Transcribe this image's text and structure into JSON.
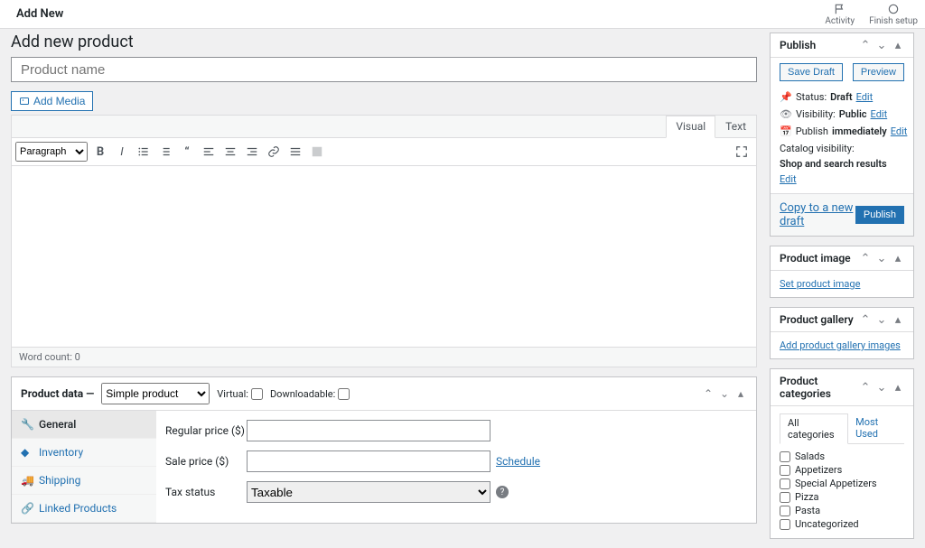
{
  "topbar": {
    "title": "Add New",
    "activity": "Activity",
    "finish_setup": "Finish setup"
  },
  "page": {
    "heading": "Add new product",
    "title_placeholder": "Product name"
  },
  "editor": {
    "add_media": "Add Media",
    "tab_visual": "Visual",
    "tab_text": "Text",
    "format_select": "Paragraph",
    "word_count_label": "Word count:",
    "word_count": "0"
  },
  "product_data": {
    "header_label": "Product data —",
    "type_selected": "Simple product",
    "virtual_label": "Virtual:",
    "downloadable_label": "Downloadable:",
    "tabs": {
      "general": "General",
      "inventory": "Inventory",
      "shipping": "Shipping",
      "linked": "Linked Products"
    },
    "general": {
      "regular_price": "Regular price ($)",
      "sale_price": "Sale price ($)",
      "schedule": "Schedule",
      "tax_status": "Tax status",
      "tax_status_selected": "Taxable"
    }
  },
  "publish": {
    "title": "Publish",
    "save_draft": "Save Draft",
    "preview": "Preview",
    "status_label": "Status:",
    "status_value": "Draft",
    "visibility_label": "Visibility:",
    "visibility_value": "Public",
    "publish_label": "Publish",
    "publish_value": "immediately",
    "catalog_label": "Catalog visibility:",
    "catalog_value": "Shop and search results",
    "edit": "Edit",
    "copy": "Copy to a new draft",
    "publish_btn": "Publish"
  },
  "product_image": {
    "title": "Product image",
    "link": "Set product image"
  },
  "product_gallery": {
    "title": "Product gallery",
    "link": "Add product gallery images"
  },
  "categories": {
    "title": "Product categories",
    "tab_all": "All categories",
    "tab_most": "Most Used",
    "items": [
      "Salads",
      "Appetizers",
      "Special Appetizers",
      "Pizza",
      "Pasta",
      "Uncategorized"
    ]
  }
}
